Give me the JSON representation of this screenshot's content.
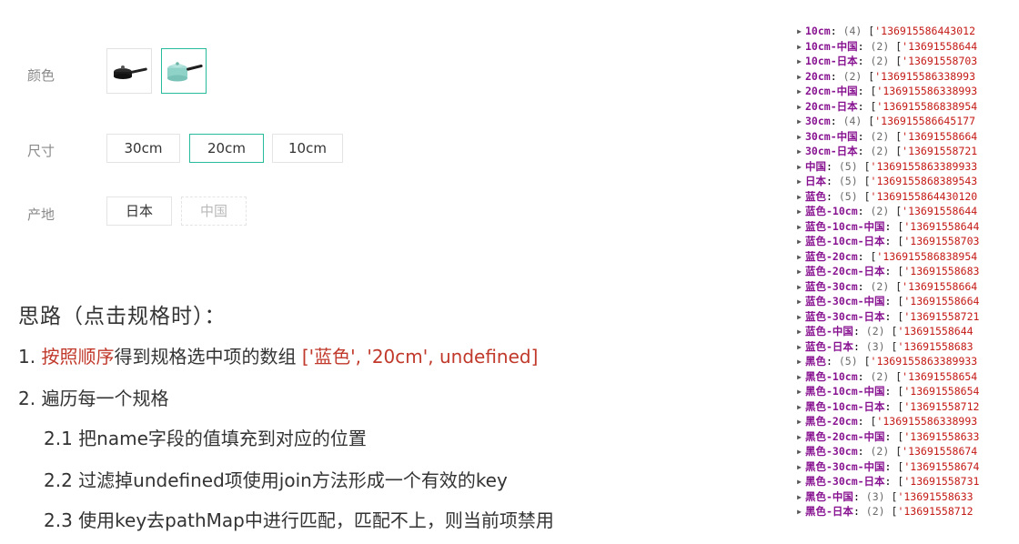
{
  "spec": {
    "color_label": "颜色",
    "color_options": [
      {
        "name": "黑色",
        "icon": "black-saucepan-icon",
        "selected": false
      },
      {
        "name": "蓝色",
        "icon": "blue-saucepan-icon",
        "selected": true
      }
    ],
    "size_label": "尺寸",
    "size_options": [
      {
        "label": "30cm",
        "state": "normal"
      },
      {
        "label": "20cm",
        "state": "selected"
      },
      {
        "label": "10cm",
        "state": "normal"
      }
    ],
    "origin_label": "产地",
    "origin_options": [
      {
        "label": "日本",
        "state": "normal"
      },
      {
        "label": "中国",
        "state": "disabled"
      }
    ],
    "accent_color": "#27ba9b"
  },
  "notes": {
    "heading": "思路（点击规格时）：",
    "step1_num": "1.",
    "step1_red": "按照顺序",
    "step1_text": "得到规格选中项的数组",
    "step1_array": "['蓝色', '20cm', undefined]",
    "step2": "2. 遍历每一个规格",
    "step2_1": "2.1 把name字段的值填充到对应的位置",
    "step2_2": "2.2 过滤掉undefined项使用join方法形成一个有效的key",
    "step2_3": "2.3 使用key去pathMap中进行匹配，匹配不上，则当前项禁用"
  },
  "console": {
    "rows": [
      {
        "key": "10cm",
        "count": "(4)",
        "value": "'136915586443012"
      },
      {
        "key": "10cm-中国",
        "count": "(2)",
        "value": "'13691558644"
      },
      {
        "key": "10cm-日本",
        "count": "(2)",
        "value": "'13691558703"
      },
      {
        "key": "20cm",
        "count": "(2)",
        "value": "'136915586338993"
      },
      {
        "key": "20cm-中国",
        "count": "",
        "value": "'136915586338993"
      },
      {
        "key": "20cm-日本",
        "count": "",
        "value": "'136915586838954"
      },
      {
        "key": "30cm",
        "count": "(4)",
        "value": "'136915586645177"
      },
      {
        "key": "30cm-中国",
        "count": "(2)",
        "value": "'13691558664"
      },
      {
        "key": "30cm-日本",
        "count": "(2)",
        "value": "'13691558721"
      },
      {
        "key": "中国",
        "count": "(5)",
        "value": "'1369155863389933"
      },
      {
        "key": "日本",
        "count": "(5)",
        "value": "'1369155868389543"
      },
      {
        "key": "蓝色",
        "count": "(5)",
        "value": "'1369155864430120"
      },
      {
        "key": "蓝色-10cm",
        "count": "(2)",
        "value": "'13691558644"
      },
      {
        "key": "蓝色-10cm-中国",
        "count": "",
        "value": "'13691558644"
      },
      {
        "key": "蓝色-10cm-日本",
        "count": "",
        "value": "'13691558703"
      },
      {
        "key": "蓝色-20cm",
        "count": "",
        "value": "'136915586838954"
      },
      {
        "key": "蓝色-20cm-日本",
        "count": "",
        "value": "'13691558683"
      },
      {
        "key": "蓝色-30cm",
        "count": "(2)",
        "value": "'13691558664"
      },
      {
        "key": "蓝色-30cm-中国",
        "count": "",
        "value": "'13691558664"
      },
      {
        "key": "蓝色-30cm-日本",
        "count": "",
        "value": "'13691558721"
      },
      {
        "key": "蓝色-中国",
        "count": "(2)",
        "value": "'13691558644"
      },
      {
        "key": "蓝色-日本",
        "count": "(3)",
        "value": "'13691558683"
      },
      {
        "key": "黑色",
        "count": "(5)",
        "value": "'1369155863389933"
      },
      {
        "key": "黑色-10cm",
        "count": "(2)",
        "value": "'13691558654"
      },
      {
        "key": "黑色-10cm-中国",
        "count": "",
        "value": "'13691558654"
      },
      {
        "key": "黑色-10cm-日本",
        "count": "",
        "value": "'13691558712"
      },
      {
        "key": "黑色-20cm",
        "count": "",
        "value": "'136915586338993"
      },
      {
        "key": "黑色-20cm-中国",
        "count": "",
        "value": "'13691558633"
      },
      {
        "key": "黑色-30cm",
        "count": "(2)",
        "value": "'13691558674"
      },
      {
        "key": "黑色-30cm-中国",
        "count": "",
        "value": "'13691558674"
      },
      {
        "key": "黑色-30cm-日本",
        "count": "",
        "value": "'13691558731"
      },
      {
        "key": "黑色-中国",
        "count": "(3)",
        "value": "'13691558633"
      },
      {
        "key": "黑色-日本",
        "count": "(2)",
        "value": "'13691558712"
      }
    ]
  }
}
